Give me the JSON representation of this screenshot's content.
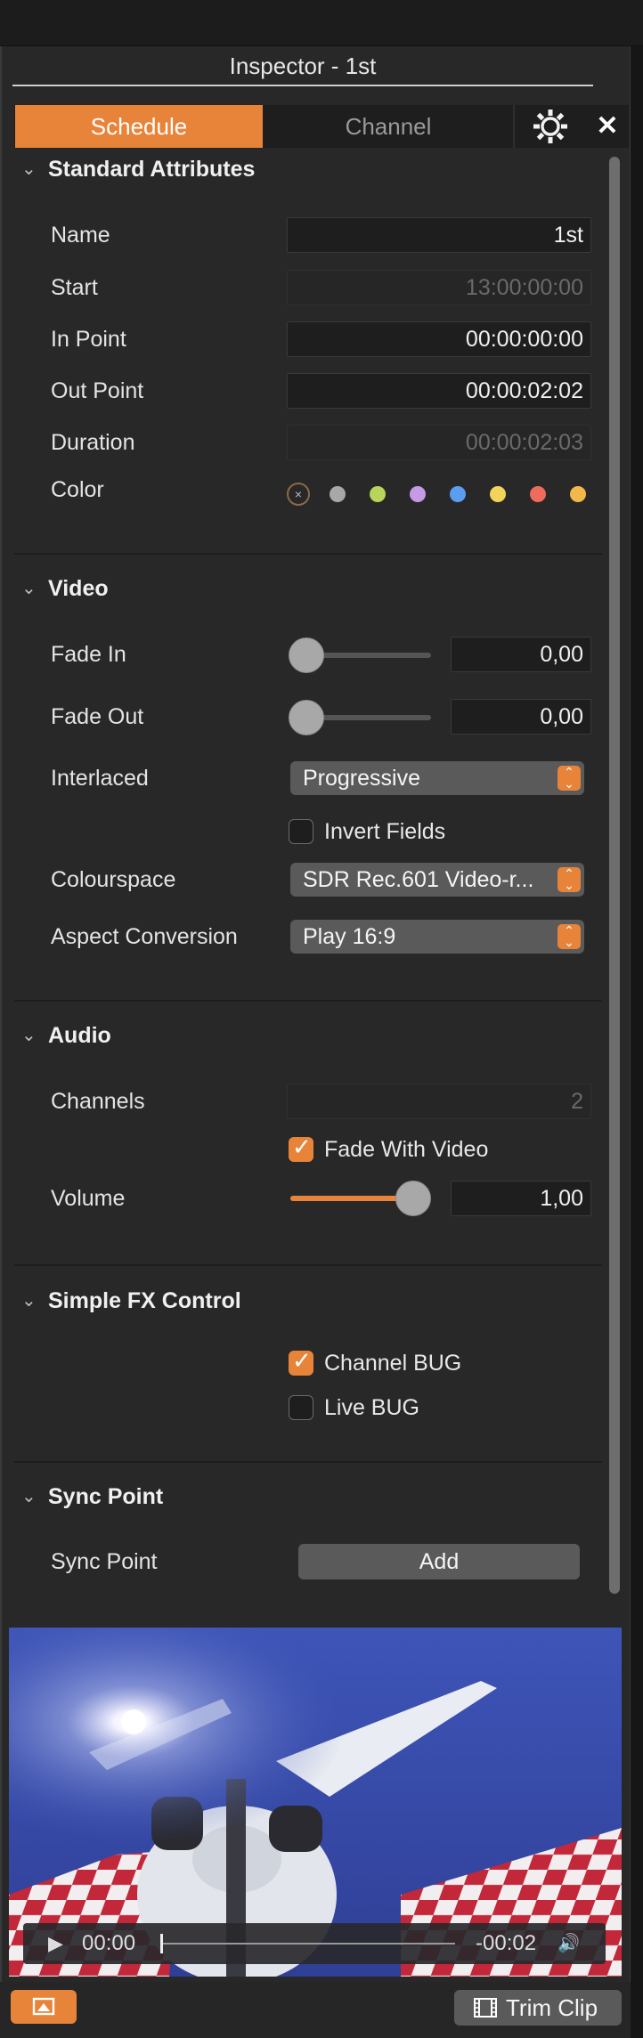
{
  "window": {
    "title": "Inspector - 1st"
  },
  "tabs": [
    {
      "label": "Schedule",
      "active": true
    },
    {
      "label": "Channel",
      "active": false
    }
  ],
  "icons": {
    "settings": "gear-icon",
    "close": "close-icon",
    "close_glyph": "✕"
  },
  "colors": {
    "accent": "#e8843a",
    "panel": "#282828",
    "field": "#1e1e1e"
  },
  "standard": {
    "title": "Standard Attributes",
    "name_label": "Name",
    "name_value": "1st",
    "start_label": "Start",
    "start_value": "13:00:00:00",
    "inpoint_label": "In Point",
    "inpoint_value": "00:00:00:00",
    "outpoint_label": "Out Point",
    "outpoint_value": "00:00:02:02",
    "duration_label": "Duration",
    "duration_value": "00:00:02:03",
    "color_label": "Color",
    "color_none_glyph": "×",
    "color_swatches": [
      "#a8a8a8",
      "#b8d45a",
      "#c79ae6",
      "#5b9ef0",
      "#f2d45a",
      "#ef6b5c",
      "#f2b94a"
    ]
  },
  "video": {
    "title": "Video",
    "fadein_label": "Fade In",
    "fadein_value": "0,00",
    "fadeout_label": "Fade Out",
    "fadeout_value": "0,00",
    "interlaced_label": "Interlaced",
    "interlaced_value": "Progressive",
    "invert_label": "Invert Fields",
    "invert_checked": false,
    "colourspace_label": "Colourspace",
    "colourspace_value": "SDR Rec.601 Video-r...",
    "aspect_label": "Aspect Conversion",
    "aspect_value": "Play 16:9"
  },
  "audio": {
    "title": "Audio",
    "channels_label": "Channels",
    "channels_value": "2",
    "fade_label": "Fade With Video",
    "fade_checked": true,
    "volume_label": "Volume",
    "volume_value": "1,00"
  },
  "fx": {
    "title": "Simple FX Control",
    "bug_label": "Channel BUG",
    "bug_checked": true,
    "live_label": "Live BUG",
    "live_checked": false
  },
  "sync": {
    "title": "Sync Point",
    "label": "Sync Point",
    "button": "Add"
  },
  "player": {
    "current_time": "00:00",
    "remaining_time": "-00:02",
    "play_glyph": "▶",
    "volume_glyph": "🔊"
  },
  "footer": {
    "trim_label": "Trim Clip"
  }
}
